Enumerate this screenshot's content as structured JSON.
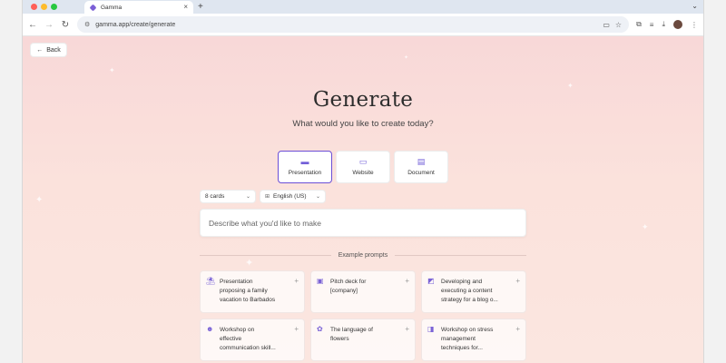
{
  "browser": {
    "tab_title": "Gamma",
    "tab_close": "×",
    "new_tab": "+",
    "tab_menu": "⌄",
    "url": "gamma.app/create/generate",
    "traffic_colors": [
      "#ff5f57",
      "#febc2e",
      "#28c840"
    ]
  },
  "page": {
    "back_label": "Back",
    "title": "Generate",
    "subtitle": "What would you like to create today?",
    "types": [
      {
        "label": "Presentation",
        "icon": "presentation-icon",
        "active": true
      },
      {
        "label": "Website",
        "icon": "website-icon",
        "active": false
      },
      {
        "label": "Document",
        "icon": "document-icon",
        "active": false
      }
    ],
    "cards_select": "8 cards",
    "language_select": "English (US)",
    "prompt_placeholder": "Describe what you'd like to make",
    "examples_heading": "Example prompts",
    "examples": [
      {
        "text": "Presentation\nproposing a family\nvacation to Barbados",
        "icon": "beach-icon"
      },
      {
        "text": "Pitch deck for\n[company]",
        "icon": "briefcase-icon"
      },
      {
        "text": "Developing and\nexecuting a content\nstrategy for a blog o...",
        "icon": "chart-icon"
      },
      {
        "text": "Workshop on\neffective\ncommunication skill...",
        "icon": "people-icon"
      },
      {
        "text": "The language of\nflowers",
        "icon": "flower-icon"
      },
      {
        "text": "Workshop on stress\nmanagement\ntechniques for...",
        "icon": "presenter-icon"
      }
    ],
    "accent_color": "#6b4fd6"
  }
}
